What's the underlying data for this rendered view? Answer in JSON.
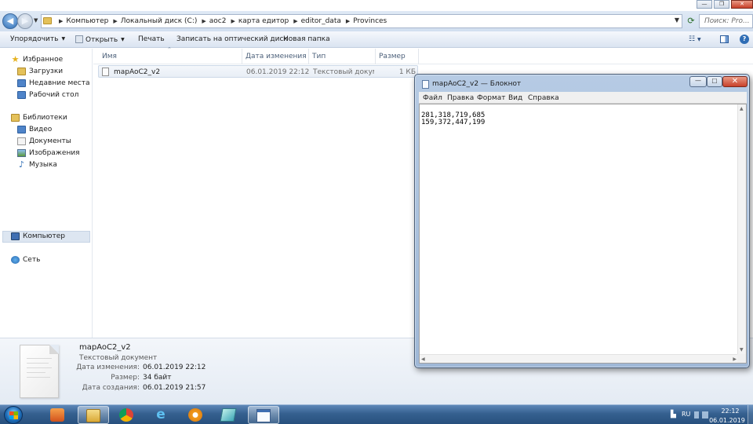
{
  "explorer": {
    "breadcrumb": [
      "Компьютер",
      "Локальный диск (C:)",
      "aoc2",
      "карта едитор",
      "editor_data",
      "Provinces"
    ],
    "search_placeholder": "Поиск: Pro...",
    "toolbar": {
      "organize": "Упорядочить",
      "open": "Открыть",
      "print": "Печать",
      "burn": "Записать на оптический диск",
      "new_folder": "Новая папка"
    },
    "nav": {
      "favorites": "Избранное",
      "downloads": "Загрузки",
      "recent": "Недавние места",
      "desktop": "Рабочий стол",
      "libraries": "Библиотеки",
      "video": "Видео",
      "documents": "Документы",
      "pictures": "Изображения",
      "music": "Музыка",
      "computer": "Компьютер",
      "network": "Сеть"
    },
    "columns": {
      "name": "Имя",
      "date": "Дата изменения",
      "type": "Тип",
      "size": "Размер"
    },
    "files": [
      {
        "name": "mapAoC2_v2",
        "date": "06.01.2019 22:12",
        "type": "Текстовый докум...",
        "size": "1 КБ"
      }
    ],
    "details": {
      "name": "mapAoC2_v2",
      "type": "Текстовый документ",
      "modified_label": "Дата изменения:",
      "modified_value": "06.01.2019 22:12",
      "size_label": "Размер:",
      "size_value": "34 байт",
      "created_label": "Дата создания:",
      "created_value": "06.01.2019 21:57"
    }
  },
  "notepad": {
    "title": "mapAoC2_v2 — Блокнот",
    "menu": [
      "Файл",
      "Правка",
      "Формат",
      "Вид",
      "Справка"
    ],
    "content": "281,318,719,685\n159,372,447,199"
  },
  "taskbar": {
    "lang": "RU",
    "time": "22:12",
    "date": "06.01.2019"
  }
}
